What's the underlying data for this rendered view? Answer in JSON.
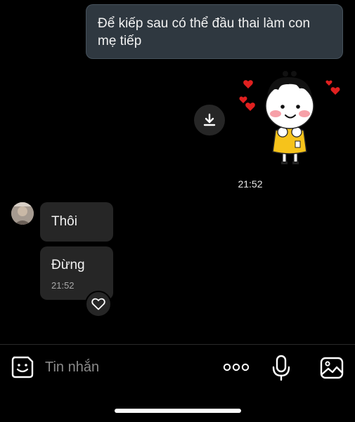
{
  "conversation": {
    "outgoing_message": "Để kiếp sau có thể đầu thai làm con mẹ tiếp",
    "sticker_timestamp": "21:52",
    "incoming_messages": [
      {
        "text": "Thôi"
      },
      {
        "text": "Đừng",
        "time": "21:52"
      }
    ],
    "reaction": "heart-icon"
  },
  "composer": {
    "placeholder": "Tin nhắn",
    "icons": [
      "sticker-face-icon",
      "more-dots-icon",
      "microphone-icon",
      "gallery-icon"
    ]
  },
  "colors": {
    "background": "#000000",
    "outgoing_bubble": "#2f3840",
    "incoming_bubble": "#262626",
    "placeholder_text": "#8a8a8a",
    "sticker_hearts": "#e0201f",
    "sticker_shirt": "#f6c31b"
  }
}
